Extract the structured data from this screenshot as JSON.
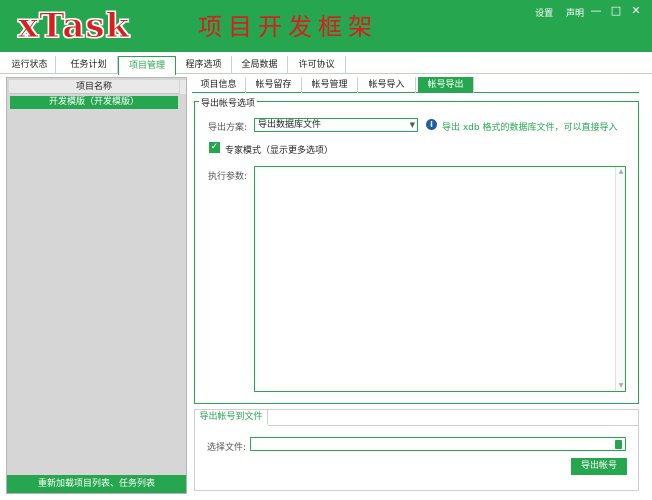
{
  "app": {
    "brand": "xTask",
    "subtitle": "项目开发框架",
    "links": [
      "设置",
      "声明"
    ],
    "window_buttons": [
      "minimize-icon",
      "maximize-icon",
      "close-icon"
    ]
  },
  "main_tabs": [
    "运行状态",
    "任务计划",
    "项目管理",
    "程序选项",
    "全局数据",
    "许可协议"
  ],
  "main_tab_active": "项目管理",
  "left_panel": {
    "header": "项目名称",
    "items": [
      "开发模版（开发模版）"
    ],
    "reload_button": "重新加载项目列表、任务列表"
  },
  "sub_tabs": [
    "项目信息",
    "帐号留存",
    "帐号管理",
    "帐号导入",
    "帐号导出"
  ],
  "sub_tab_active": "帐号导出",
  "export_options": {
    "group_title": "导出帐号选项",
    "scheme_label": "导出方案:",
    "scheme_value": "导出数据库文件",
    "hint": "导出 xdb 格式的数据库文件，可以直接导入",
    "expert_mode_label": "专家模式（显示更多选项）",
    "expert_mode_checked": true,
    "params_label": "执行参数:",
    "params_value": ""
  },
  "export_file": {
    "tab": "导出帐号到文件",
    "file_label": "选择文件:",
    "file_value": "",
    "export_button": "导出帐号"
  },
  "colors": {
    "accent": "#27a650",
    "brand_red": "#d81e1e"
  }
}
